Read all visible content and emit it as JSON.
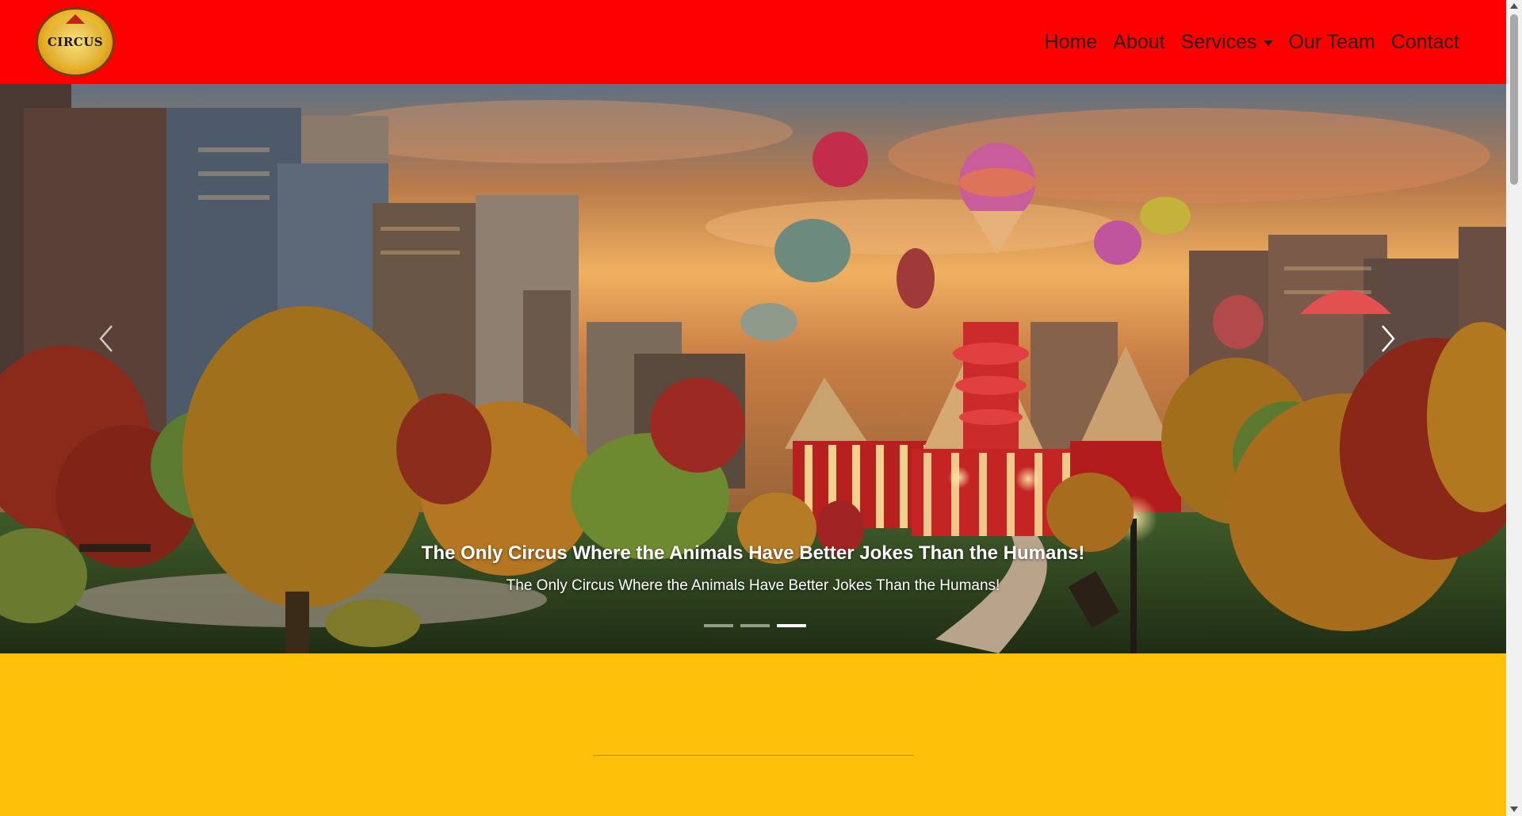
{
  "navbar": {
    "logo_text": "CIRCUS",
    "links": [
      {
        "label": "Home"
      },
      {
        "label": "About"
      },
      {
        "label": "Services"
      },
      {
        "label": "Our Team"
      },
      {
        "label": "Contact"
      }
    ],
    "background_color": "#ff0000"
  },
  "hero": {
    "caption_title": "The Only Circus Where the Animals Have Better Jokes Than the Humans!",
    "caption_subtitle": "The Only Circus Where the Animals Have Better Jokes Than the Humans!",
    "prev_icon": "chevron-left-icon",
    "next_icon": "chevron-right-icon",
    "slide_count": 3,
    "active_slide": 3
  },
  "section": {
    "background_color": "#ffc107"
  }
}
